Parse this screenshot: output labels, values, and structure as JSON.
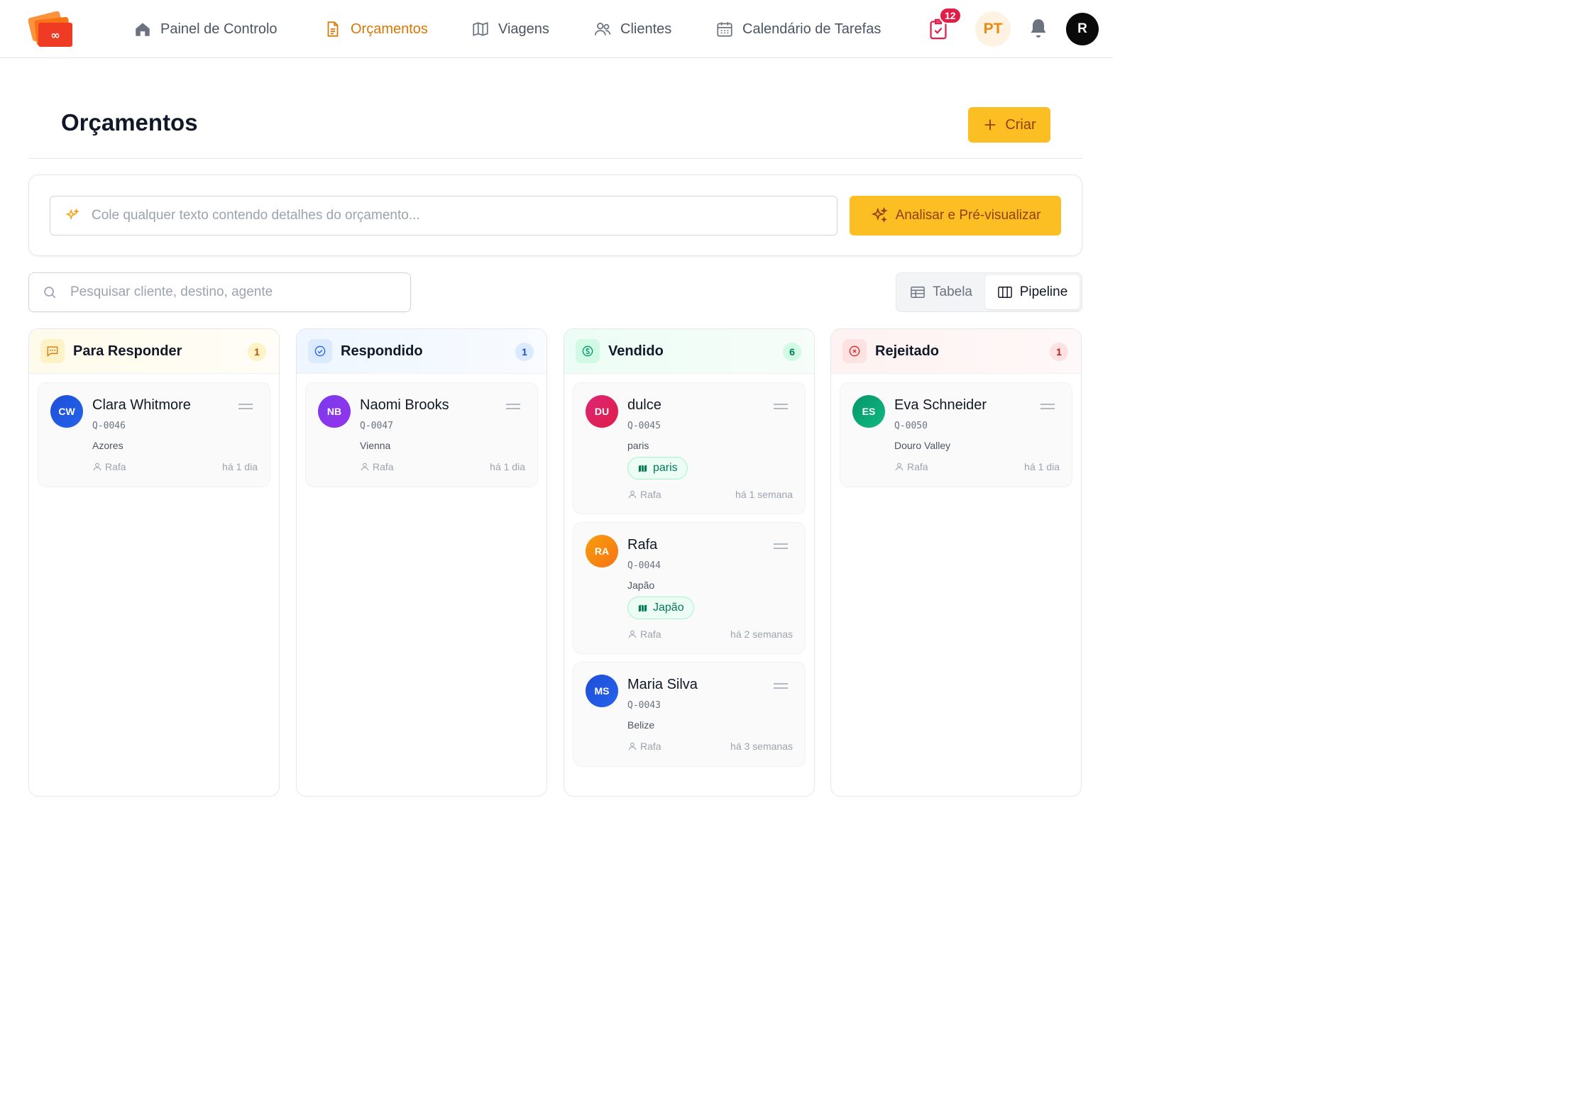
{
  "nav": {
    "items": [
      {
        "label": "Painel de Controlo",
        "icon": "home-icon"
      },
      {
        "label": "Orçamentos",
        "icon": "document-icon",
        "active": true
      },
      {
        "label": "Viagens",
        "icon": "map-icon"
      },
      {
        "label": "Clientes",
        "icon": "users-icon"
      },
      {
        "label": "Calendário de Tarefas",
        "icon": "calendar-icon"
      }
    ],
    "task_badge": "12",
    "language": "PT",
    "user_initial": "R"
  },
  "header": {
    "title": "Orçamentos",
    "create_label": "Criar"
  },
  "parse": {
    "placeholder": "Cole qualquer texto contendo detalhes do orçamento...",
    "button_label": "Analisar e Pré-visualizar"
  },
  "search": {
    "placeholder": "Pesquisar cliente, destino, agente"
  },
  "view_toggle": {
    "table_label": "Tabela",
    "pipeline_label": "Pipeline",
    "selected": "Pipeline"
  },
  "columns": [
    {
      "title": "Para Responder",
      "count": "1",
      "icon": "chat-icon",
      "cards": [
        {
          "initials": "CW",
          "name": "Clara Whitmore",
          "id": "Q-0046",
          "destination": "Azores",
          "agent": "Rafa",
          "time": "há 1 dia"
        }
      ]
    },
    {
      "title": "Respondido",
      "count": "1",
      "icon": "check-circle-icon",
      "cards": [
        {
          "initials": "NB",
          "name": "Naomi Brooks",
          "id": "Q-0047",
          "destination": "Vienna",
          "agent": "Rafa",
          "time": "há 1 dia"
        }
      ]
    },
    {
      "title": "Vendido",
      "count": "6",
      "icon": "dollar-icon",
      "cards": [
        {
          "initials": "DU",
          "name": "dulce",
          "id": "Q-0045",
          "destination": "paris",
          "tag": "paris",
          "agent": "Rafa",
          "time": "há 1 semana"
        },
        {
          "initials": "RA",
          "name": "Rafa",
          "id": "Q-0044",
          "destination": "Japão",
          "tag": "Japão",
          "agent": "Rafa",
          "time": "há 2 semanas"
        },
        {
          "initials": "MS",
          "name": "Maria Silva",
          "id": "Q-0043",
          "destination": "Belize",
          "agent": "Rafa",
          "time": "há 3 semanas"
        }
      ]
    },
    {
      "title": "Rejeitado",
      "count": "1",
      "icon": "x-circle-icon",
      "cards": [
        {
          "initials": "ES",
          "name": "Eva Schneider",
          "id": "Q-0050",
          "destination": "Douro Valley",
          "agent": "Rafa",
          "time": "há 1 dia"
        }
      ]
    }
  ],
  "colors": {
    "accent": "#fbbf24",
    "accent_text": "#92400e",
    "active_nav": "#d97706",
    "badge": "#e11d48"
  }
}
